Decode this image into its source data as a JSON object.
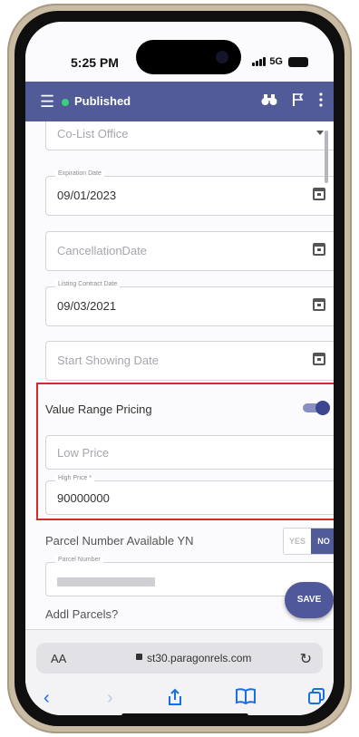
{
  "status_bar": {
    "time": "5:25 PM",
    "network": "5G"
  },
  "app_bar": {
    "status": "Published"
  },
  "form": {
    "co_list_office": {
      "placeholder": "Co-List Office"
    },
    "expiration_date": {
      "label": "Expiration Date",
      "value": "09/01/2023"
    },
    "cancellation_date": {
      "placeholder": "CancellationDate"
    },
    "listing_contract_date": {
      "label": "Listing Contract Date",
      "value": "09/03/2021"
    },
    "start_showing_date": {
      "placeholder": "Start Showing Date"
    },
    "value_range_pricing": {
      "label": "Value Range Pricing",
      "enabled": true
    },
    "low_price": {
      "placeholder": "Low Price"
    },
    "high_price": {
      "label": "High Price *",
      "value": "90000000"
    },
    "parcel_available": {
      "label": "Parcel Number Available YN",
      "yes": "YES",
      "no": "NO",
      "selected": "NO"
    },
    "parcel_number": {
      "label": "Parcel Number"
    },
    "addl_parcels": {
      "label": "Addl Parcels?"
    }
  },
  "save_label": "SAVE",
  "browser": {
    "aa": "AA",
    "domain": "st30.paragonrels.com"
  },
  "colors": {
    "app_bar": "#515b97",
    "highlight": "#d52a2a",
    "toolbar_icons": "#1a6fe0"
  }
}
